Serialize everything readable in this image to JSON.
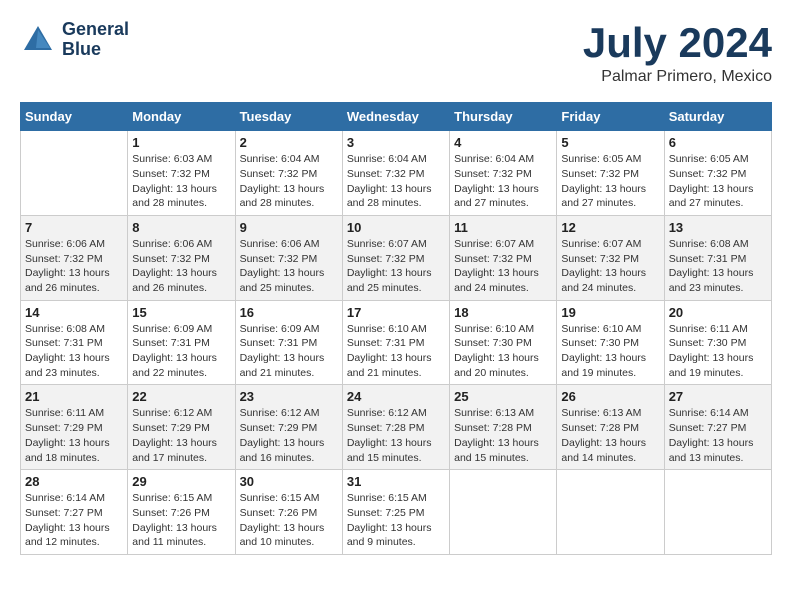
{
  "header": {
    "logo_line1": "General",
    "logo_line2": "Blue",
    "month_year": "July 2024",
    "location": "Palmar Primero, Mexico"
  },
  "weekdays": [
    "Sunday",
    "Monday",
    "Tuesday",
    "Wednesday",
    "Thursday",
    "Friday",
    "Saturday"
  ],
  "weeks": [
    [
      {
        "day": "",
        "empty": true
      },
      {
        "day": "1",
        "sunrise": "6:03 AM",
        "sunset": "7:32 PM",
        "daylight": "13 hours and 28 minutes."
      },
      {
        "day": "2",
        "sunrise": "6:04 AM",
        "sunset": "7:32 PM",
        "daylight": "13 hours and 28 minutes."
      },
      {
        "day": "3",
        "sunrise": "6:04 AM",
        "sunset": "7:32 PM",
        "daylight": "13 hours and 28 minutes."
      },
      {
        "day": "4",
        "sunrise": "6:04 AM",
        "sunset": "7:32 PM",
        "daylight": "13 hours and 27 minutes."
      },
      {
        "day": "5",
        "sunrise": "6:05 AM",
        "sunset": "7:32 PM",
        "daylight": "13 hours and 27 minutes."
      },
      {
        "day": "6",
        "sunrise": "6:05 AM",
        "sunset": "7:32 PM",
        "daylight": "13 hours and 27 minutes."
      }
    ],
    [
      {
        "day": "7",
        "sunrise": "6:06 AM",
        "sunset": "7:32 PM",
        "daylight": "13 hours and 26 minutes."
      },
      {
        "day": "8",
        "sunrise": "6:06 AM",
        "sunset": "7:32 PM",
        "daylight": "13 hours and 26 minutes."
      },
      {
        "day": "9",
        "sunrise": "6:06 AM",
        "sunset": "7:32 PM",
        "daylight": "13 hours and 25 minutes."
      },
      {
        "day": "10",
        "sunrise": "6:07 AM",
        "sunset": "7:32 PM",
        "daylight": "13 hours and 25 minutes."
      },
      {
        "day": "11",
        "sunrise": "6:07 AM",
        "sunset": "7:32 PM",
        "daylight": "13 hours and 24 minutes."
      },
      {
        "day": "12",
        "sunrise": "6:07 AM",
        "sunset": "7:32 PM",
        "daylight": "13 hours and 24 minutes."
      },
      {
        "day": "13",
        "sunrise": "6:08 AM",
        "sunset": "7:31 PM",
        "daylight": "13 hours and 23 minutes."
      }
    ],
    [
      {
        "day": "14",
        "sunrise": "6:08 AM",
        "sunset": "7:31 PM",
        "daylight": "13 hours and 23 minutes."
      },
      {
        "day": "15",
        "sunrise": "6:09 AM",
        "sunset": "7:31 PM",
        "daylight": "13 hours and 22 minutes."
      },
      {
        "day": "16",
        "sunrise": "6:09 AM",
        "sunset": "7:31 PM",
        "daylight": "13 hours and 21 minutes."
      },
      {
        "day": "17",
        "sunrise": "6:10 AM",
        "sunset": "7:31 PM",
        "daylight": "13 hours and 21 minutes."
      },
      {
        "day": "18",
        "sunrise": "6:10 AM",
        "sunset": "7:30 PM",
        "daylight": "13 hours and 20 minutes."
      },
      {
        "day": "19",
        "sunrise": "6:10 AM",
        "sunset": "7:30 PM",
        "daylight": "13 hours and 19 minutes."
      },
      {
        "day": "20",
        "sunrise": "6:11 AM",
        "sunset": "7:30 PM",
        "daylight": "13 hours and 19 minutes."
      }
    ],
    [
      {
        "day": "21",
        "sunrise": "6:11 AM",
        "sunset": "7:29 PM",
        "daylight": "13 hours and 18 minutes."
      },
      {
        "day": "22",
        "sunrise": "6:12 AM",
        "sunset": "7:29 PM",
        "daylight": "13 hours and 17 minutes."
      },
      {
        "day": "23",
        "sunrise": "6:12 AM",
        "sunset": "7:29 PM",
        "daylight": "13 hours and 16 minutes."
      },
      {
        "day": "24",
        "sunrise": "6:12 AM",
        "sunset": "7:28 PM",
        "daylight": "13 hours and 15 minutes."
      },
      {
        "day": "25",
        "sunrise": "6:13 AM",
        "sunset": "7:28 PM",
        "daylight": "13 hours and 15 minutes."
      },
      {
        "day": "26",
        "sunrise": "6:13 AM",
        "sunset": "7:28 PM",
        "daylight": "13 hours and 14 minutes."
      },
      {
        "day": "27",
        "sunrise": "6:14 AM",
        "sunset": "7:27 PM",
        "daylight": "13 hours and 13 minutes."
      }
    ],
    [
      {
        "day": "28",
        "sunrise": "6:14 AM",
        "sunset": "7:27 PM",
        "daylight": "13 hours and 12 minutes."
      },
      {
        "day": "29",
        "sunrise": "6:15 AM",
        "sunset": "7:26 PM",
        "daylight": "13 hours and 11 minutes."
      },
      {
        "day": "30",
        "sunrise": "6:15 AM",
        "sunset": "7:26 PM",
        "daylight": "13 hours and 10 minutes."
      },
      {
        "day": "31",
        "sunrise": "6:15 AM",
        "sunset": "7:25 PM",
        "daylight": "13 hours and 9 minutes."
      },
      {
        "day": "",
        "empty": true
      },
      {
        "day": "",
        "empty": true
      },
      {
        "day": "",
        "empty": true
      }
    ]
  ]
}
